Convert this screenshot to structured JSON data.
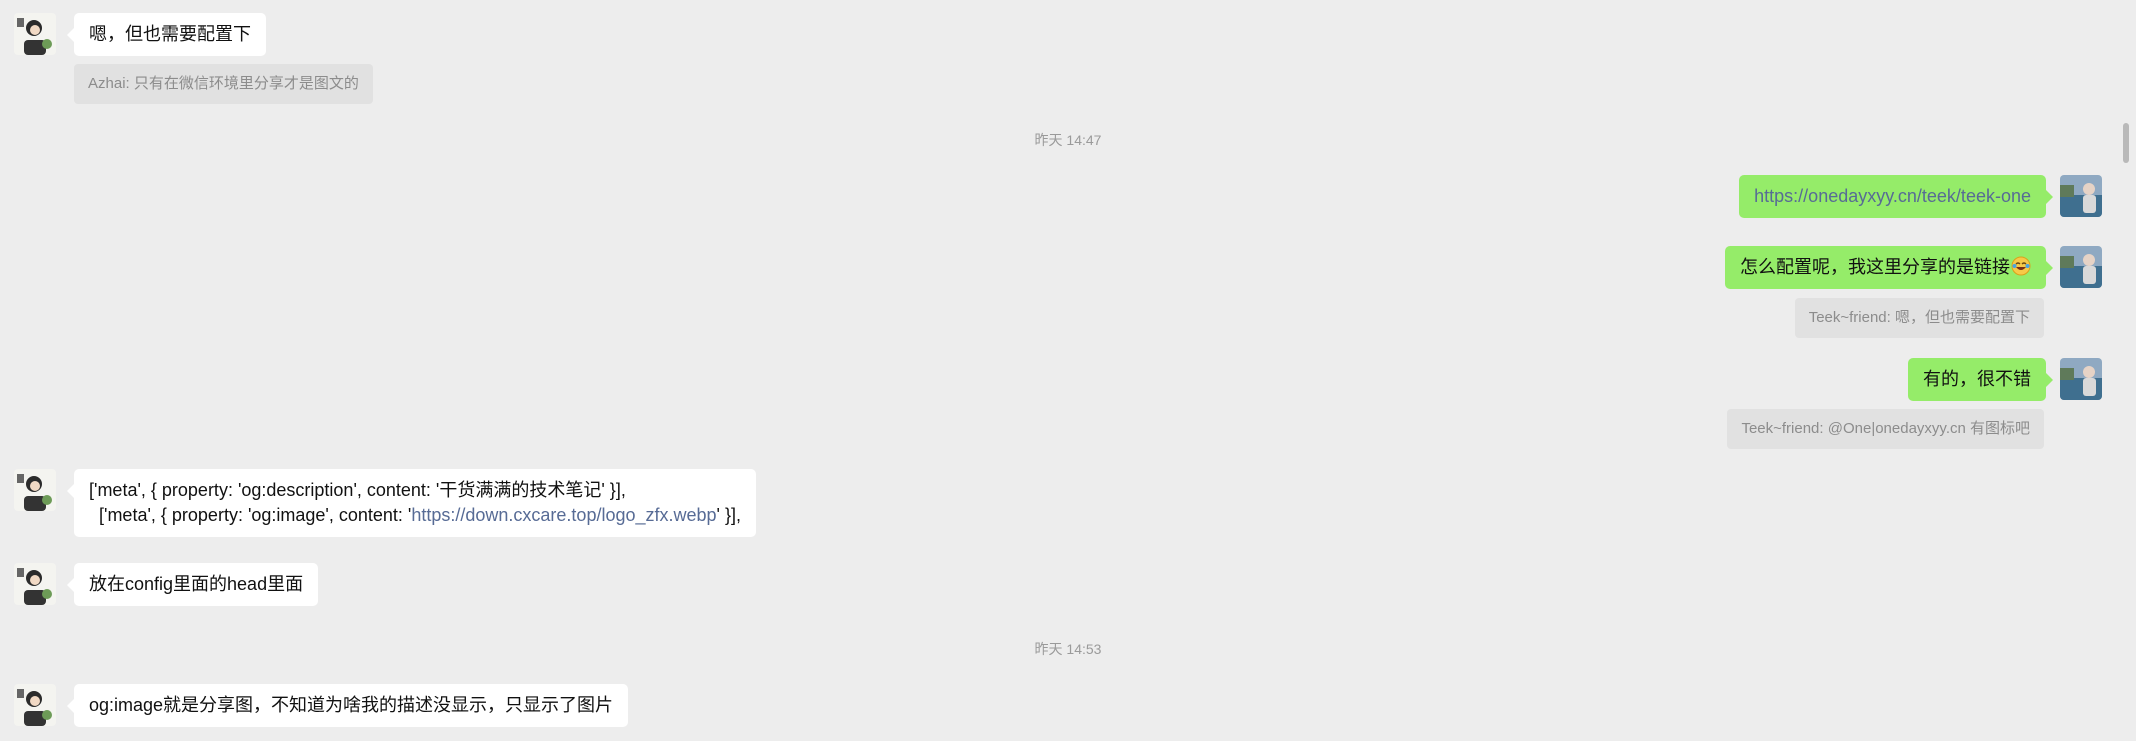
{
  "messages": {
    "m1": {
      "text": "嗯，但也需要配置下"
    },
    "q1": {
      "text": "Azhai: 只有在微信环境里分享才是图文的"
    },
    "ts1": {
      "text": "昨天 14:47"
    },
    "m2": {
      "text": "https://onedayxyy.cn/teek/teek-one"
    },
    "m3": {
      "text": "怎么配置呢，我这里分享的是链接",
      "emoji": "laughing-tears-emoji"
    },
    "q3": {
      "text": "Teek~friend: 嗯，但也需要配置下"
    },
    "m4": {
      "text": "有的，很不错"
    },
    "q4": {
      "text": "Teek~friend: @One|onedayxyy.cn 有图标吧"
    },
    "m5": {
      "line1": "['meta', { property: 'og:description', content: '干货满满的技术笔记' }],",
      "line2_prefix": "  ['meta', { property: 'og:image', content: '",
      "line2_link": "https://down.cxcare.top/logo_zfx.webp",
      "line2_suffix": "' }],"
    },
    "m6": {
      "text": "放在config里面的head里面"
    },
    "ts2": {
      "text": "昨天 14:53"
    },
    "m7": {
      "text": "og:image就是分享图，不知道为啥我的描述没显示，只显示了图片"
    }
  },
  "colors": {
    "background": "#ededed",
    "bubble_incoming": "#ffffff",
    "bubble_outgoing": "#95ec69",
    "quote_bg": "#e1e1e1",
    "link": "#576b95"
  }
}
